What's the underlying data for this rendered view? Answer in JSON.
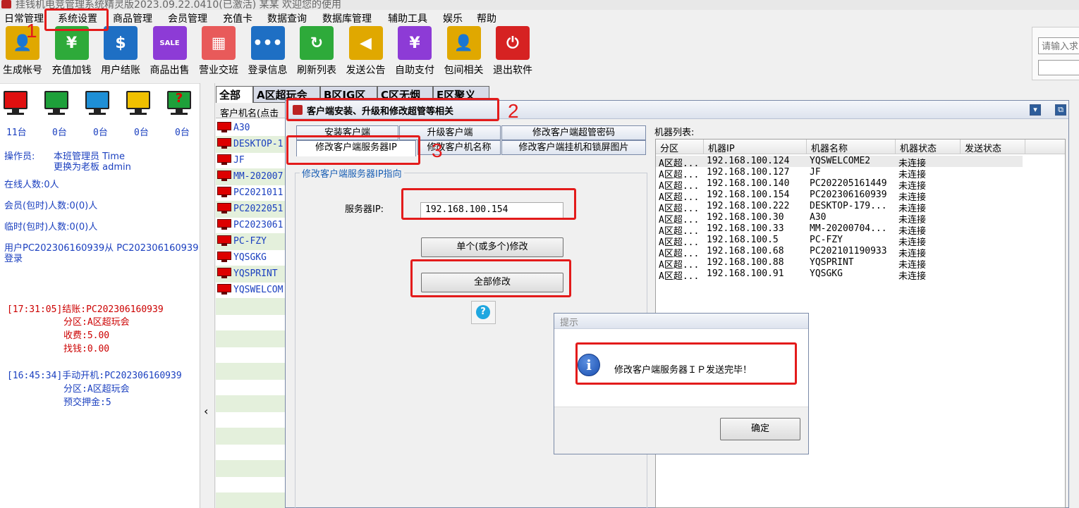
{
  "title_bar": {
    "text": "挂钱机电竞管理系统精灵版2023.09.22.0410(已激活) 某某 欢迎您的使用"
  },
  "menu": [
    "日常管理",
    "系统设置",
    "商品管理",
    "会员管理",
    "充值卡",
    "数据查询",
    "数据库管理",
    "辅助工具",
    "娱乐",
    "帮助"
  ],
  "toolbar": [
    {
      "label": "生成帐号",
      "icon": "user-icon",
      "color": "#e0a800",
      "glyph": "👤"
    },
    {
      "label": "充值加钱",
      "icon": "piggy-bank-icon",
      "color": "#2eaa3a",
      "glyph": "¥"
    },
    {
      "label": "用户结账",
      "icon": "bill-icon",
      "color": "#1e6fc4",
      "glyph": "$"
    },
    {
      "label": "商品出售",
      "icon": "sale-tag-icon",
      "color": "#8d3bd6",
      "glyph": "SALE"
    },
    {
      "label": "营业交班",
      "icon": "shop-icon",
      "color": "#e85a5a",
      "glyph": "▦"
    },
    {
      "label": "登录信息",
      "icon": "chat-icon",
      "color": "#1e6fc4",
      "glyph": "•••"
    },
    {
      "label": "刷新列表",
      "icon": "refresh-icon",
      "color": "#2eaa3a",
      "glyph": "↻"
    },
    {
      "label": "发送公告",
      "icon": "megaphone-icon",
      "color": "#e0a800",
      "glyph": "◀"
    },
    {
      "label": "自助支付",
      "icon": "yen-card-icon",
      "color": "#8d3bd6",
      "glyph": "¥"
    },
    {
      "label": "包间相关",
      "icon": "person-icon",
      "color": "#e0a800",
      "glyph": "👤"
    },
    {
      "label": "退出软件",
      "icon": "power-icon",
      "color": "#d62222",
      "glyph": "⏻"
    }
  ],
  "search": {
    "placeholder": "请输入求"
  },
  "status_monitors": [
    {
      "color": "#e01010",
      "count": "11台",
      "icon": "monitor-red-icon"
    },
    {
      "color": "#1ea03a",
      "count": "0台",
      "icon": "monitor-green-icon"
    },
    {
      "color": "#1e8fd6",
      "count": "0台",
      "icon": "monitor-blue-icon"
    },
    {
      "color": "#f0c000",
      "count": "0台",
      "icon": "monitor-yellow-icon"
    },
    {
      "color": "#1ea03a",
      "count": "0台",
      "icon": "monitor-unknown-icon",
      "mark": "?"
    }
  ],
  "left_info": {
    "operator_label": "操作员:",
    "operator_value": "本班管理员 Time",
    "operator_switch": "更换为老板 admin",
    "online": "在线人数:0人",
    "members": "会员(包时)人数:0(0)人",
    "temp": "临时(包时)人数:0(0)人",
    "login_msg_1": "用户PC202306160939从 PC202306160939",
    "login_msg_2": "登录"
  },
  "log": [
    {
      "line1": "[17:31:05]结账:PC202306160939",
      "line2": "分区:A区超玩会",
      "line3": "收费:5.00",
      "line4": "找钱:0.00"
    },
    {
      "line1": "[16:45:34]手动开机:PC202306160939",
      "line2": "分区:A区超玩会",
      "line3": "预交押金:5"
    }
  ],
  "center_tabs": [
    "全部",
    "A区超玩会",
    "B区IG区",
    "C区无烟",
    "E区聚义"
  ],
  "client_list": {
    "header": "客户机名(点击",
    "rows": [
      "A30",
      "DESKTOP-1",
      "JF",
      "MM-202007",
      "PC2021011",
      "PC2022051",
      "PC2023061",
      "PC-FZY",
      "YQSGKG",
      "YQSPRINT",
      "YQSWELCOM"
    ]
  },
  "dialog": {
    "title": "客户端安装、升级和修改超管等相关",
    "tabs_row1": [
      "安装客户端",
      "升级客户端",
      "修改客户端超管密码"
    ],
    "tabs_row2": [
      "修改客户端服务器IP",
      "修改客户机名称",
      "修改客户端挂机和锁屏图片"
    ],
    "group_title": "修改客户端服务器IP指向",
    "server_label": "服务器IP:",
    "server_value": "192.168.100.154",
    "btn_single": "单个(或多个)修改",
    "btn_all": "全部修改",
    "help": "?",
    "machine_list_label": "机器列表:",
    "machine_headers": [
      "分区",
      "机器IP",
      "机器名称",
      "机器状态",
      "发送状态"
    ],
    "machines": [
      [
        "A区超...",
        "192.168.100.124",
        "YQSWELCOME2",
        "未连接",
        ""
      ],
      [
        "A区超...",
        "192.168.100.127",
        "JF",
        "未连接",
        ""
      ],
      [
        "A区超...",
        "192.168.100.140",
        "PC202205161449",
        "未连接",
        ""
      ],
      [
        "A区超...",
        "192.168.100.154",
        "PC202306160939",
        "未连接",
        ""
      ],
      [
        "A区超...",
        "192.168.100.222",
        "DESKTOP-179...",
        "未连接",
        ""
      ],
      [
        "A区超...",
        "192.168.100.30",
        "A30",
        "未连接",
        ""
      ],
      [
        "A区超...",
        "192.168.100.33",
        "MM-20200704...",
        "未连接",
        ""
      ],
      [
        "A区超...",
        "192.168.100.5",
        "PC-FZY",
        "未连接",
        ""
      ],
      [
        "A区超...",
        "192.168.100.68",
        "PC202101190933",
        "未连接",
        ""
      ],
      [
        "A区超...",
        "192.168.100.88",
        "YQSPRINT",
        "未连接",
        ""
      ],
      [
        "A区超...",
        "192.168.100.91",
        "YQSGKG",
        "未连接",
        ""
      ]
    ]
  },
  "msgbox": {
    "title": "提示",
    "text": "修改客户端服务器ＩＰ发送完毕！",
    "ok": "确定"
  },
  "annotations": [
    "1",
    "2",
    "3"
  ]
}
